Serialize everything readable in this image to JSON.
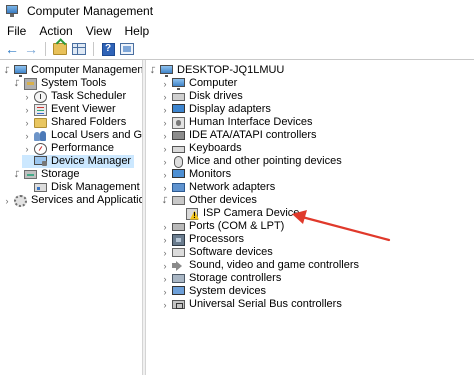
{
  "window": {
    "title": "Computer Management"
  },
  "menu": [
    "File",
    "Action",
    "View",
    "Help"
  ],
  "toolbar": {
    "buttons": [
      "back-icon",
      "forward-icon",
      "up-folder-icon",
      "show-hide-tree-icon",
      "help-icon",
      "help-topics-icon"
    ]
  },
  "left_tree": [
    {
      "label": "Computer Management (Local",
      "icon": "computer-icon",
      "level": 0,
      "toggle": "expanded"
    },
    {
      "label": "System Tools",
      "icon": "tools-icon",
      "level": 1,
      "toggle": "expanded"
    },
    {
      "label": "Task Scheduler",
      "icon": "clock-icon",
      "level": 2,
      "toggle": "collapsed"
    },
    {
      "label": "Event Viewer",
      "icon": "event-viewer-icon",
      "level": 2,
      "toggle": "collapsed"
    },
    {
      "label": "Shared Folders",
      "icon": "folder-icon",
      "level": 2,
      "toggle": "collapsed"
    },
    {
      "label": "Local Users and Groups",
      "icon": "users-icon",
      "level": 2,
      "toggle": "collapsed"
    },
    {
      "label": "Performance",
      "icon": "performance-icon",
      "level": 2,
      "toggle": "collapsed"
    },
    {
      "label": "Device Manager",
      "icon": "device-manager-icon",
      "level": 2,
      "toggle": "none",
      "selected": true
    },
    {
      "label": "Storage",
      "icon": "storage-icon",
      "level": 1,
      "toggle": "expanded"
    },
    {
      "label": "Disk Management",
      "icon": "disk-icon",
      "level": 2,
      "toggle": "none"
    },
    {
      "label": "Services and Applications",
      "icon": "services-icon",
      "level": 1,
      "toggle": "collapsed"
    }
  ],
  "device_tree": {
    "root": "DESKTOP-JQ1LMUU",
    "categories": [
      {
        "label": "Computer",
        "icon": "computer-icon"
      },
      {
        "label": "Disk drives",
        "icon": "disk-drive-icon"
      },
      {
        "label": "Display adapters",
        "icon": "display-adapter-icon"
      },
      {
        "label": "Human Interface Devices",
        "icon": "hid-icon"
      },
      {
        "label": "IDE ATA/ATAPI controllers",
        "icon": "ide-controller-icon"
      },
      {
        "label": "Keyboards",
        "icon": "keyboard-icon"
      },
      {
        "label": "Mice and other pointing devices",
        "icon": "mouse-icon"
      },
      {
        "label": "Monitors",
        "icon": "monitor-icon"
      },
      {
        "label": "Network adapters",
        "icon": "network-adapter-icon"
      },
      {
        "label": "Other devices",
        "icon": "other-devices-icon",
        "expanded": true,
        "children": [
          {
            "label": "ISP Camera Device",
            "icon": "warning-device-icon"
          }
        ]
      },
      {
        "label": "Ports (COM & LPT)",
        "icon": "ports-icon"
      },
      {
        "label": "Processors",
        "icon": "processor-icon"
      },
      {
        "label": "Software devices",
        "icon": "software-device-icon"
      },
      {
        "label": "Sound, video and game controllers",
        "icon": "sound-icon"
      },
      {
        "label": "Storage controllers",
        "icon": "storage-controller-icon"
      },
      {
        "label": "System devices",
        "icon": "system-device-icon"
      },
      {
        "label": "Universal Serial Bus controllers",
        "icon": "usb-icon"
      }
    ]
  },
  "colors": {
    "selection": "#cce8ff",
    "annotation_arrow": "#e0392b"
  }
}
